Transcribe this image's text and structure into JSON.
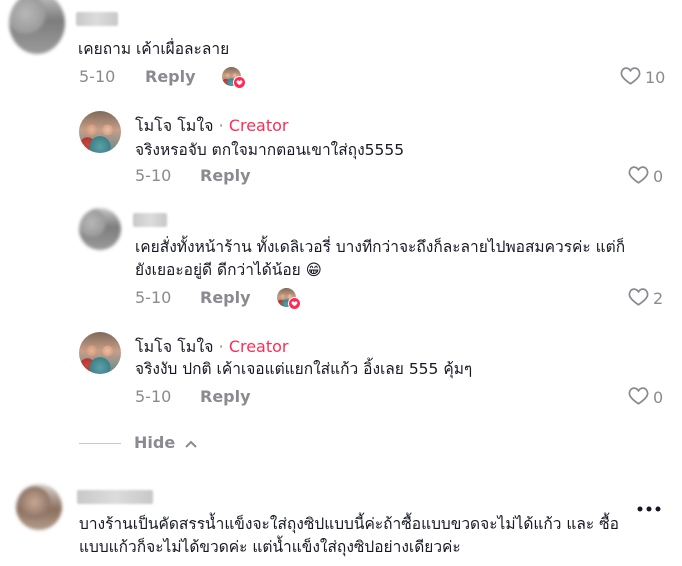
{
  "comments": [
    {
      "text": "เคยถาม เค้าเผื่อละลาย",
      "date": "5-10",
      "reply_label": "Reply",
      "likes": "10"
    },
    {
      "author": "โมโจ โมใจ",
      "separator": "·",
      "badge": "Creator",
      "text": "จริงหรอจับ ตกใจมากตอนเขาใส่ถุง5555",
      "date": "5-10",
      "reply_label": "Reply",
      "likes": "0"
    },
    {
      "text_line1": "เคยสั่งทั้งหน้าร้าน ทั้งเดลิเวอรี่ บางทีกว่าจะถึงก็ละลายไปพอสมควรค่ะ แต่ก็",
      "text_line2": "ยังเยอะอยู่ดี ดีกว่าได้น้อย 😁",
      "date": "5-10",
      "reply_label": "Reply",
      "likes": "2"
    },
    {
      "author": "โมโจ โมใจ",
      "separator": "·",
      "badge": "Creator",
      "text": "จริงงับ ปกติ เค้าเจอแต่แยกใส่แก้ว อิ้งเลย 555 คุ้มๆ",
      "date": "5-10",
      "reply_label": "Reply",
      "likes": "0"
    },
    {
      "text_line1": "บางร้านเป็นคัดสรรน้ำแข็งจะใส่ถุงซิปแบบนี้ค่ะถ้าซื้อแบบขวดจะไม่ได้แก้ว และ ซื้อ",
      "text_line2": "แบบแก้วก็จะไม่ได้ขวดค่ะ แต่น้ำแข็งใส่ถุงซิปอย่างเดียวค่ะ"
    }
  ],
  "hide_label": "Hide",
  "colors": {
    "accent": "#fe2c55",
    "muted": "#8a8b91",
    "text": "#161823"
  },
  "icons": [
    "heart-outline-icon",
    "chevron-up-icon",
    "more-dots-icon",
    "heart-badge-icon"
  ]
}
